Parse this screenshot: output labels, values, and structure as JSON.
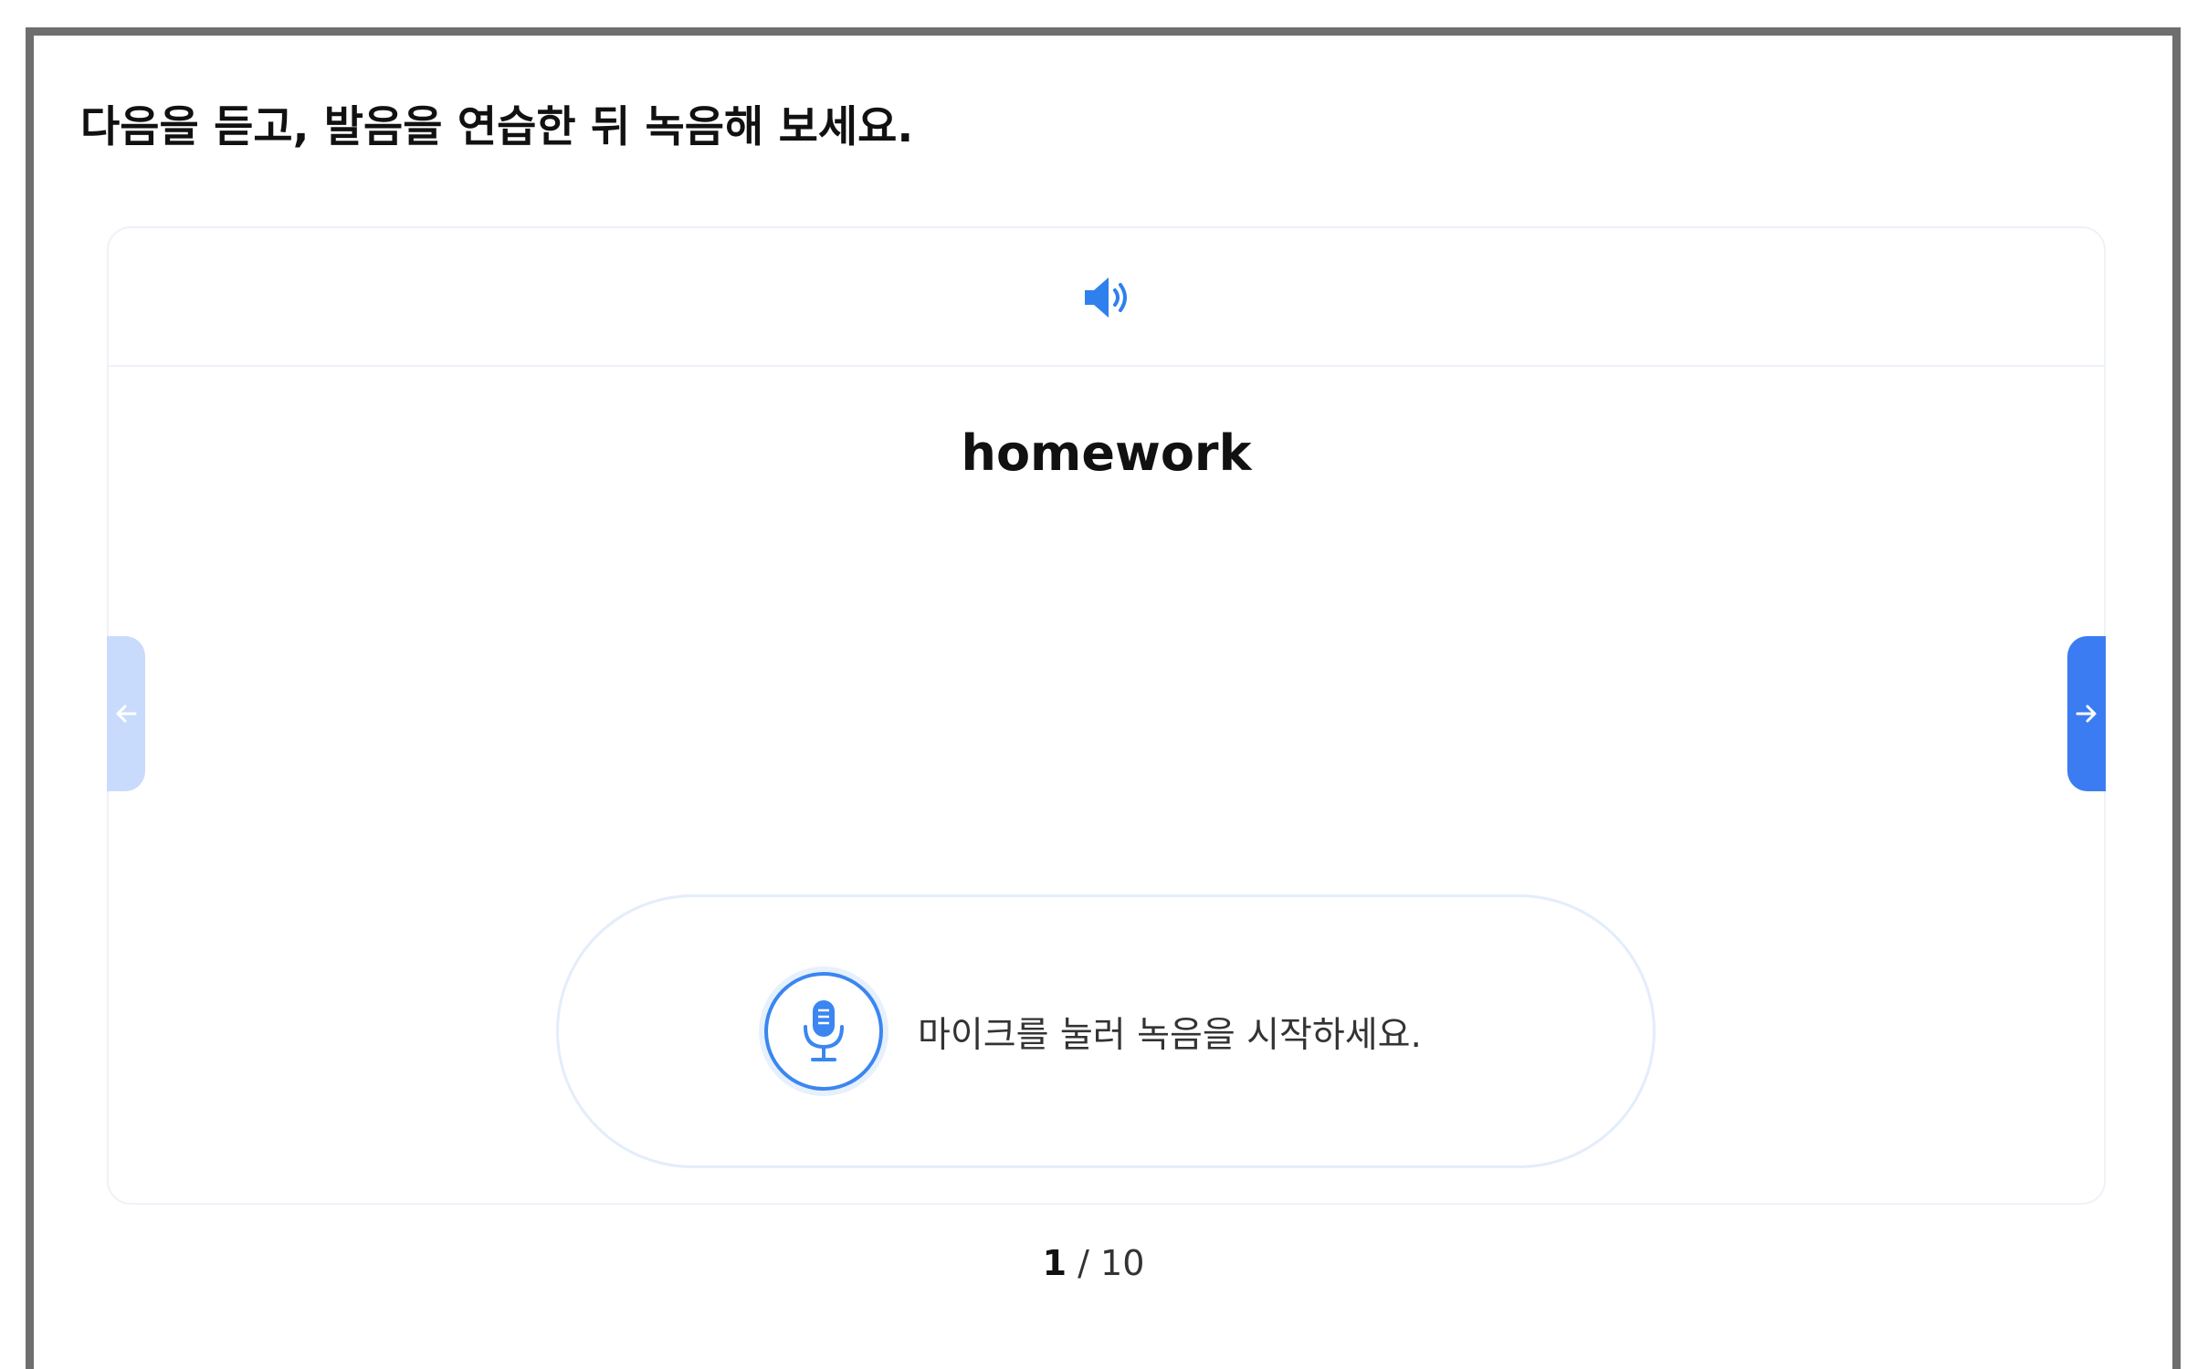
{
  "instruction": "다음을 듣고, 발음을 연습한 뒤 녹음해 보세요.",
  "card": {
    "speaker_icon": "speaker-volume-icon",
    "word": "homework"
  },
  "navigation": {
    "prev_icon": "arrow-left-icon",
    "next_icon": "arrow-right-icon",
    "prev_enabled": false,
    "next_enabled": true
  },
  "recorder": {
    "mic_icon": "microphone-icon",
    "hint": "마이크를 눌러 녹음을 시작하세요."
  },
  "pager": {
    "current": "1",
    "separator": " / ",
    "total": "10"
  },
  "colors": {
    "accent": "#3b7cf2",
    "accent_disabled": "#c9dbfc",
    "mic_border": "#3b86f0",
    "frame_border": "#6e6e6e"
  }
}
